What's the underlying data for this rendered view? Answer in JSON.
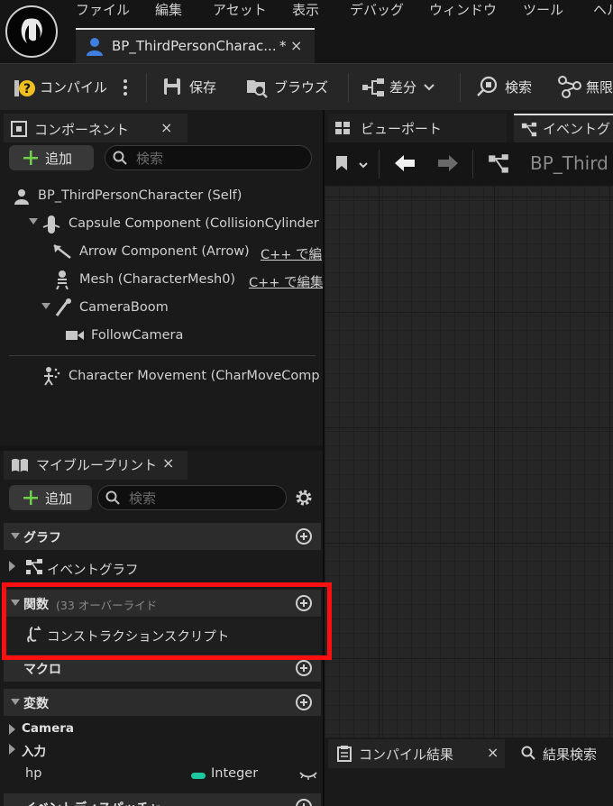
{
  "menu": [
    "ファイル",
    "編集",
    "アセット",
    "表示",
    "デバッグ",
    "ウィンドウ",
    "ツール",
    "ヘル"
  ],
  "doc_tab": {
    "title": "BP_ThirdPersonCharac...",
    "modified": "*",
    "close": "×"
  },
  "toolbar": {
    "compile": "コンパイル",
    "save": "保存",
    "browse": "ブラウズ",
    "diff": "差分",
    "search": "検索",
    "last": "無限"
  },
  "components_panel": {
    "title": "コンポーネント",
    "close": "×",
    "add": "追加",
    "search_placeholder": "検索",
    "tree": {
      "root": "BP_ThirdPersonCharacter (Self)",
      "capsule": "Capsule Component (CollisionCylinder",
      "arrow": "Arrow Component (Arrow)",
      "arrow_link": "C++ で編",
      "mesh": "Mesh (CharacterMesh0)",
      "mesh_link": "C++ で編集",
      "boom": "CameraBoom",
      "camera": "FollowCamera",
      "movement": "Character Movement (CharMoveComp"
    }
  },
  "viewport_tabs": {
    "viewport": "ビューポート",
    "event": "イベントグ"
  },
  "graph_nav": {
    "breadcrumb": "BP_Third"
  },
  "my_blueprint": {
    "title": "マイブループリント",
    "close": "×",
    "add": "追加",
    "search_placeholder": "検索",
    "sections": {
      "graph": "グラフ",
      "event_graph": "イベントグラフ",
      "functions": "関数",
      "functions_overrides": "(33 オーバーライド",
      "construction_script": "コンストラクションスクリプト",
      "macros": "マクロ",
      "variables": "変数",
      "camera_cat": "Camera",
      "input_cat": "入力",
      "var_hp": "hp",
      "var_hp_type": "Integer",
      "event_dispatchers": "イベントディスパッチャ"
    }
  },
  "bottom_tabs": {
    "compile_results": "コンパイル結果",
    "close": "×",
    "find_results": "結果検索"
  },
  "colors": {
    "integer_pin": "#1fc8a0",
    "highlight": "#ff1010",
    "add_plus": "#6fd04a"
  }
}
